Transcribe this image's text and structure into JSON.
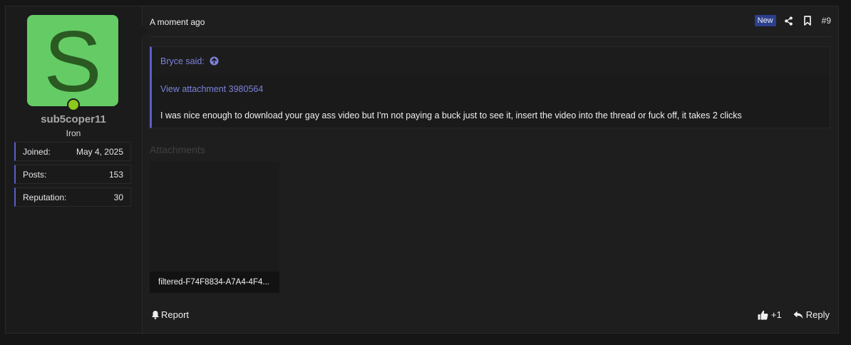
{
  "user": {
    "avatar_letter": "S",
    "avatar_color": "#65cc65",
    "online_color": "#8cc91a",
    "username": "sub5coper11",
    "title": "Iron",
    "stats": [
      {
        "label": "Joined:",
        "value": "May 4, 2025"
      },
      {
        "label": "Posts:",
        "value": "153"
      },
      {
        "label": "Reputation:",
        "value": "30"
      }
    ]
  },
  "header": {
    "timestamp": "A moment ago",
    "badge": "New",
    "post_number": "#9",
    "icons": [
      "share-icon",
      "bookmark-icon"
    ]
  },
  "quote": {
    "author": "Bryce said:",
    "attachment_link": "View attachment 3980564",
    "body": "I was nice enough to download your gay ass video but I'm not paying a buck just to see it, insert the video into the thread or fuck off, it takes 2 clicks"
  },
  "attachments": {
    "label": "Attachments",
    "items": [
      {
        "filename": "filtered-F74F8834-A7A4-4F4..."
      }
    ]
  },
  "footer": {
    "report": "Report",
    "like_count": "+1",
    "reply": "Reply"
  },
  "colors": {
    "accent": "#5a5fc8",
    "link": "#7d82dc",
    "badge_bg": "#2b3f8c"
  }
}
